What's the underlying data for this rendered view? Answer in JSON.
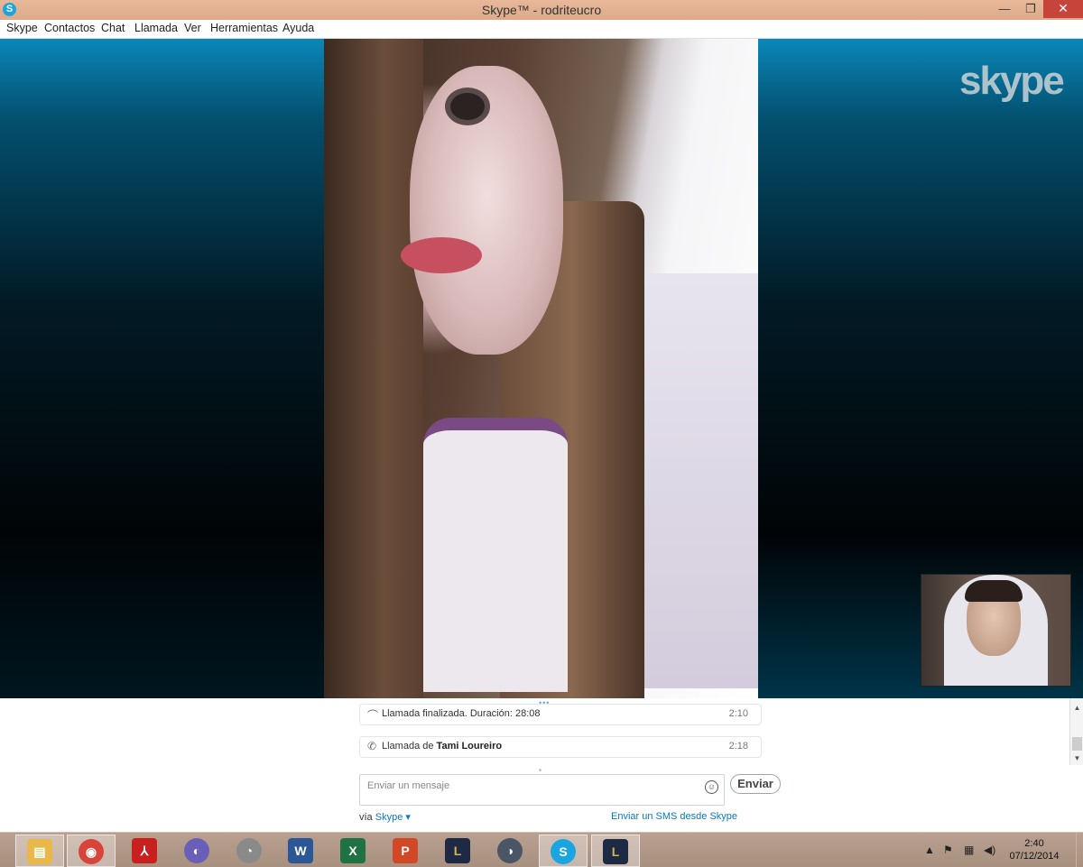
{
  "window": {
    "title": "Skype™ - rodriteucro",
    "app_icon_letter": "S",
    "minimize_glyph": "—",
    "restore_glyph": "❐",
    "close_glyph": "✕"
  },
  "menu": [
    "Skype",
    "Contactos",
    "Chat",
    "Llamada",
    "Ver",
    "Herramientas",
    "Ayuda"
  ],
  "video": {
    "watermark": "skype"
  },
  "chat": {
    "messages": [
      {
        "icon": "call-ended-icon",
        "glyph": "⌒",
        "text": "Llamada finalizada. Duración: 28:08",
        "time": "2:10"
      },
      {
        "icon": "phone-icon",
        "glyph": "✆",
        "text_prefix": "Llamada de ",
        "text_bold": "Tami Loureiro",
        "time": "2:18"
      }
    ],
    "compose_placeholder": "Enviar un mensaje",
    "send_label": "Enviar",
    "via_prefix": "vía ",
    "via_link": "Skype ▾",
    "sms_link": "Enviar un SMS desde Skype"
  },
  "taskbar": {
    "apps": [
      {
        "name": "file-explorer",
        "glyph": "▤",
        "color": "#e8b84a"
      },
      {
        "name": "chrome",
        "glyph": "◉",
        "color": "#d9443a"
      },
      {
        "name": "adobe-reader",
        "glyph": "⅄",
        "color": "#c8201e"
      },
      {
        "name": "bittorrent",
        "glyph": "◐",
        "color": "#6a5fb8"
      },
      {
        "name": "media-app",
        "glyph": "◔",
        "color": "#8a8a8a"
      },
      {
        "name": "word",
        "glyph": "W",
        "color": "#2b5797"
      },
      {
        "name": "excel",
        "glyph": "X",
        "color": "#1f7244"
      },
      {
        "name": "powerpoint",
        "glyph": "P",
        "color": "#d24726"
      },
      {
        "name": "league-of-legends",
        "glyph": "L",
        "color": "#1e2a44"
      },
      {
        "name": "steam-like",
        "glyph": "◑",
        "color": "#4a5566"
      },
      {
        "name": "skype",
        "glyph": "S",
        "color": "#1aa5e0"
      },
      {
        "name": "league-of-legends-2",
        "glyph": "L",
        "color": "#1e2a44"
      }
    ],
    "time": "2:40",
    "date": "07/12/2014"
  }
}
